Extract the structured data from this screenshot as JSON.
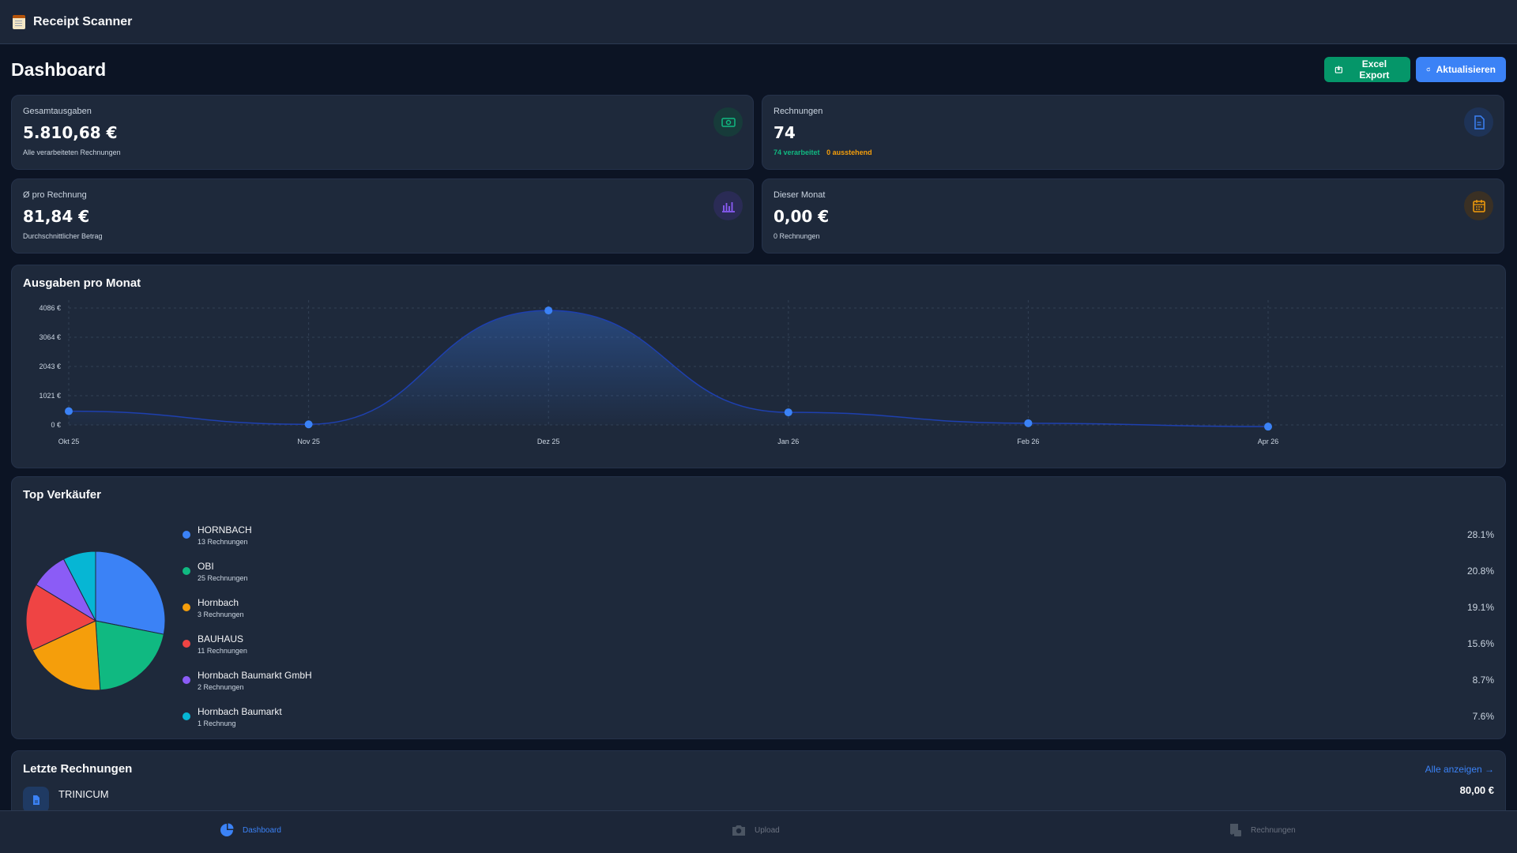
{
  "app": {
    "title": "Receipt Scanner",
    "logo_icon": "receipt-icon"
  },
  "page": {
    "title": "Dashboard"
  },
  "actions": {
    "export_label": "Excel Export",
    "refresh_label": "Aktualisieren"
  },
  "stats": {
    "total": {
      "label": "Gesamtausgaben",
      "value": "5.810,68 €",
      "sub": "Alle verarbeiteten Rechnungen",
      "icon": "money-icon",
      "color": "#10b981"
    },
    "invoices": {
      "label": "Rechnungen",
      "value": "74",
      "processed": "74 verarbeitet",
      "pending": "0 ausstehend",
      "icon": "document-icon",
      "color": "#3b82f6"
    },
    "average": {
      "label": "Ø pro Rechnung",
      "value": "81,84 €",
      "sub": "Durchschnittlicher Betrag",
      "icon": "bar-chart-icon",
      "color": "#8b5cf6"
    },
    "month": {
      "label": "Dieser Monat",
      "value": "0,00 €",
      "sub": "0 Rechnungen",
      "icon": "calendar-icon",
      "color": "#f59e0b"
    }
  },
  "chart": {
    "title": "Ausgaben pro Monat",
    "y_ticks": [
      "0 €",
      "1021 €",
      "2043 €",
      "3064 €",
      "4086 €"
    ]
  },
  "chart_data": {
    "type": "area",
    "title": "Ausgaben pro Monat",
    "categories": [
      "Okt 25",
      "Nov 25",
      "Dez 25",
      "Jan 26",
      "Feb 26",
      "Apr 26"
    ],
    "values": [
      480,
      20,
      4000,
      440,
      60,
      -60
    ],
    "ylim": [
      0,
      4086
    ],
    "grid": true,
    "color": "#3b82f6"
  },
  "vendors": {
    "title": "Top Verkäufer",
    "items": [
      {
        "name": "HORNBACH",
        "count": "13 Rechnungen",
        "pct": "28.1%",
        "value": 28.1,
        "color": "#3b82f6"
      },
      {
        "name": "OBI",
        "count": "25 Rechnungen",
        "pct": "20.8%",
        "value": 20.8,
        "color": "#10b981"
      },
      {
        "name": "Hornbach",
        "count": "3 Rechnungen",
        "pct": "19.1%",
        "value": 19.1,
        "color": "#f59e0b"
      },
      {
        "name": "BAUHAUS",
        "count": "11 Rechnungen",
        "pct": "15.6%",
        "value": 15.6,
        "color": "#ef4444"
      },
      {
        "name": "Hornbach Baumarkt GmbH",
        "count": "2 Rechnungen",
        "pct": "8.7%",
        "value": 8.7,
        "color": "#8b5cf6"
      },
      {
        "name": "Hornbach Baumarkt",
        "count": "1 Rechnung",
        "pct": "7.6%",
        "value": 7.6,
        "color": "#06b6d4"
      }
    ]
  },
  "recent": {
    "title": "Letzte Rechnungen",
    "link": "Alle anzeigen →",
    "items": [
      {
        "name": "TRINICUM",
        "amount": "80,00 €"
      }
    ]
  },
  "nav": {
    "dashboard": "Dashboard",
    "upload": "Upload",
    "invoices": "Rechnungen"
  }
}
